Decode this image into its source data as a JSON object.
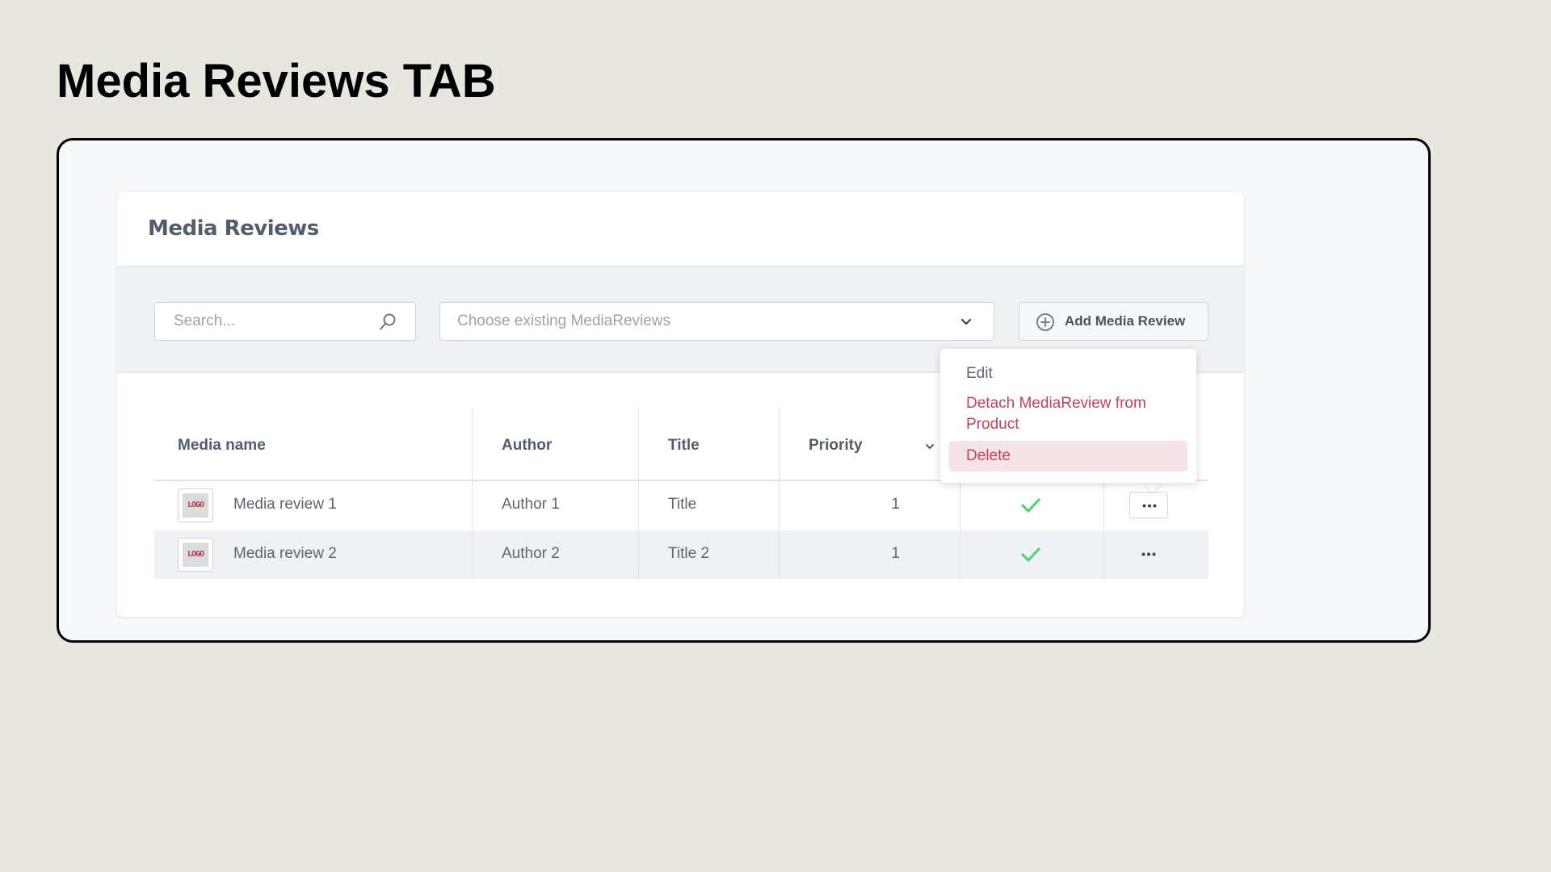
{
  "slide": {
    "title": "Media Reviews TAB"
  },
  "card": {
    "title": "Media Reviews"
  },
  "toolbar": {
    "search_placeholder": "Search...",
    "choose_placeholder": "Choose existing MediaReviews",
    "add_label": "Add Media Review"
  },
  "table": {
    "headers": {
      "media_name": "Media name",
      "author": "Author",
      "title": "Title",
      "priority": "Priority"
    },
    "rows": [
      {
        "thumb": "LOGO",
        "media_name": "Media review 1",
        "author": "Author 1",
        "title": "Title",
        "priority": "1",
        "checked": true
      },
      {
        "thumb": "LOGO",
        "media_name": "Media review 2",
        "author": "Author 2",
        "title": "Title 2",
        "priority": "1",
        "checked": true
      }
    ]
  },
  "menu": {
    "edit": "Edit",
    "detach": "Detach MediaReview from Product",
    "delete": "Delete"
  },
  "icons": {
    "search": "search-icon",
    "chevron": "chevron-down-icon",
    "add": "plus-circle-icon",
    "check": "check-icon",
    "more": "more-dots-icon"
  },
  "colors": {
    "background": "#e7e7e0",
    "danger": "#c1415a",
    "danger_bg": "#f5e3e7",
    "success": "#5ccf7e",
    "muted_text": "#5d6674"
  }
}
